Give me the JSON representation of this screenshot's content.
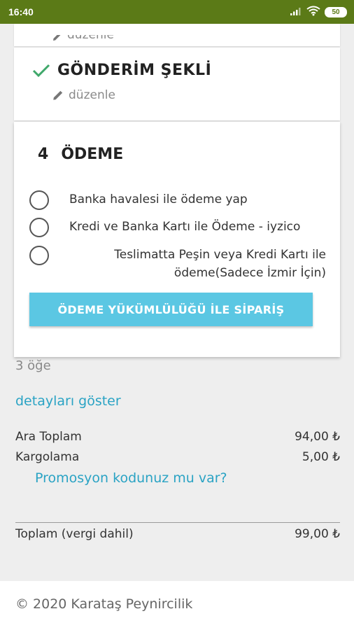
{
  "status_bar": {
    "time": "16:40",
    "battery": "50"
  },
  "previous_step": {
    "edit_label": "düzenle"
  },
  "shipping": {
    "title": "GÖNDERİM ŞEKLİ",
    "edit_label": "düzenle",
    "completed": true
  },
  "payment": {
    "step_number": "4",
    "title": "ÖDEME",
    "options": [
      {
        "label": "Banka havalesi ile ödeme yap",
        "selected": false
      },
      {
        "label": "Kredi ve Banka Kartı ile Ödeme - iyzico",
        "selected": false
      },
      {
        "label": "Teslimatta Peşin veya Kredi Kartı ile ödeme(Sadece İzmir İçin)",
        "selected": false
      }
    ],
    "button_label": "ÖDEME YÜKÜMLÜLÜĞÜ İLE SİPARİŞ"
  },
  "cart_summary": {
    "item_count": "3 öğe",
    "details_link": "detayları göster",
    "subtotal_label": "Ara Toplam",
    "subtotal_value": "94,00 ₺",
    "shipping_label": "Kargolama",
    "shipping_value": "5,00 ₺",
    "promo_link": "Promosyon kodunuz mu var?",
    "total_label": "Toplam (vergi dahil)",
    "total_value": "99,00 ₺"
  },
  "footer": {
    "copyright": "© 2020 Karataş Peynircilik"
  },
  "colors": {
    "status_bar": "#5b7a17",
    "accent_link": "#2aa3c4",
    "button": "#5bc7e3",
    "check": "#3fa86a"
  }
}
